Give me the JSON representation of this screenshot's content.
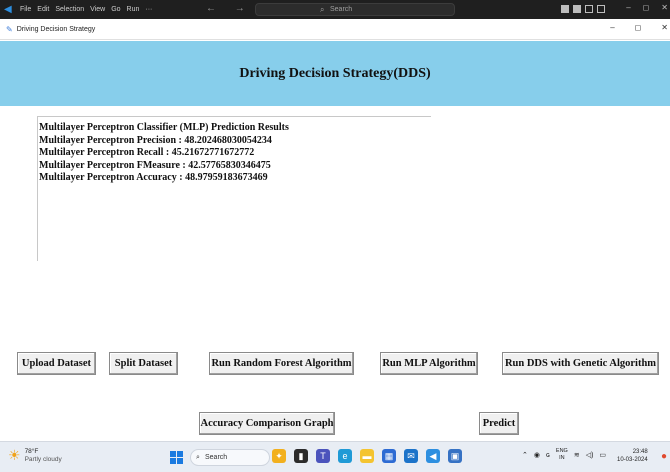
{
  "vscode": {
    "menu": [
      "File",
      "Edit",
      "Selection",
      "View",
      "Go",
      "Run",
      "···"
    ],
    "nav_arrows": "← →",
    "search_placeholder": "Search",
    "window_controls": [
      "–",
      "◻",
      "✕"
    ]
  },
  "window": {
    "title": "Driving Decision Strategy",
    "controls": [
      "–",
      "◻",
      "✕"
    ]
  },
  "app": {
    "heading": "Driving Decision Strategy(DDS)",
    "results": [
      "Multilayer Perceptron Classifier (MLP) Prediction Results",
      "Multilayer Perceptron Precision : 48.202468030054234",
      "Multilayer Perceptron Recall : 45.21672771672772",
      "Multilayer Perceptron FMeasure : 42.57765830346475",
      "Multilayer Perceptron Accuracy : 48.97959183673469"
    ],
    "buttons": {
      "upload": "Upload Dataset",
      "split": "Split Dataset",
      "random_forest": "Run Random Forest Algorithm",
      "mlp": "Run MLP Algorithm",
      "dds": "Run DDS with Genetic Algorithm",
      "accuracy_graph": "Accuracy Comparison Graph",
      "predict": "Predict"
    },
    "colors": {
      "heading_bg": "#87ceeb"
    }
  },
  "taskbar": {
    "weather_temp": "78°F",
    "weather_desc": "Partly cloudy",
    "search_placeholder": "Search",
    "tray_lang": "ENG",
    "tray_region": "IN",
    "time": "23:48",
    "date": "10-03-2024"
  }
}
